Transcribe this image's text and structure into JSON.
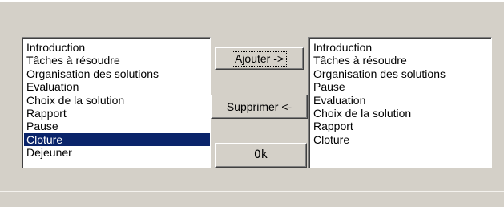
{
  "left_list": {
    "items": [
      "Introduction",
      "Tâches à résoudre",
      "Organisation des solutions",
      "Evaluation",
      "Choix de la solution",
      "Rapport",
      "Pause",
      "Cloture",
      "Dejeuner"
    ],
    "selected": "Cloture"
  },
  "right_list": {
    "items": [
      "Introduction",
      "Tâches à résoudre",
      "Organisation des solutions",
      "Pause",
      "Evaluation",
      "Choix de la solution",
      "Rapport",
      "Cloture"
    ]
  },
  "buttons": {
    "add_label": "Ajouter ->",
    "remove_label": "Supprimer <-",
    "ok_label": "Ok"
  },
  "colors": {
    "background": "#d4d0c8",
    "selection": "#0a246a",
    "list_background": "#ffffff"
  }
}
